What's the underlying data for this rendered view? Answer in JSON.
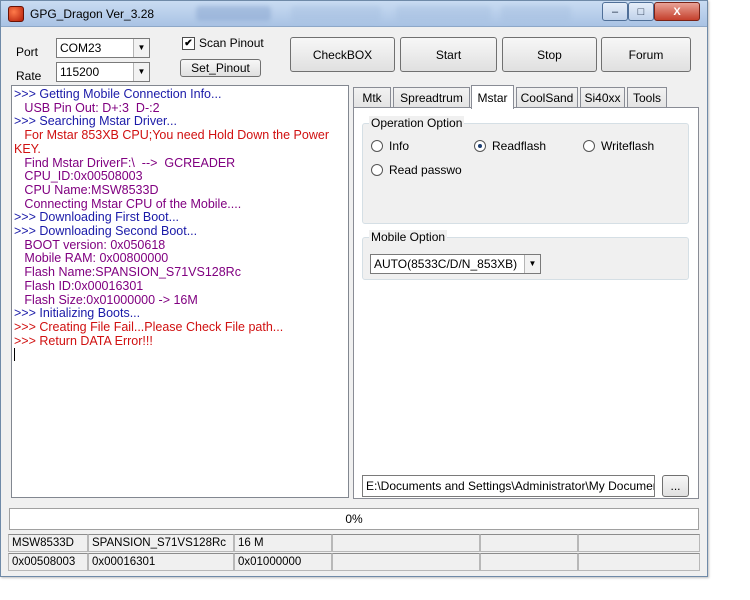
{
  "window": {
    "title": "GPG_Dragon  Ver_3.28",
    "controls": {
      "minimize": "–",
      "maximize": "□",
      "close": "X"
    }
  },
  "connection": {
    "port_label": "Port",
    "port_value": "COM23",
    "rate_label": "Rate",
    "rate_value": "115200",
    "scan_pinout_label": "Scan Pinout",
    "scan_pinout_checked": true,
    "set_pinout_label": "Set_Pinout"
  },
  "toolbar": {
    "checkbox_label": "CheckBOX",
    "start_label": "Start",
    "stop_label": "Stop",
    "forum_label": "Forum"
  },
  "log": [
    {
      "text": ">>> Getting Mobile Connection Info...",
      "color": "blue"
    },
    {
      "text": "   USB Pin Out: D+:3  D-:2",
      "color": "purple"
    },
    {
      "text": ">>> Searching Mstar Driver...",
      "color": "blue"
    },
    {
      "text": "   For Mstar 853XB CPU;You need Hold Down the Power KEY.",
      "color": "red"
    },
    {
      "text": "   Find Mstar DriverF:\\  -->  GCREADER",
      "color": "purple"
    },
    {
      "text": "   CPU_ID:0x00508003",
      "color": "purple"
    },
    {
      "text": "   CPU Name:MSW8533D",
      "color": "purple"
    },
    {
      "text": "   Connecting Mstar CPU of the Mobile....",
      "color": "purple"
    },
    {
      "text": ">>> Downloading First Boot...",
      "color": "blue"
    },
    {
      "text": ">>> Downloading Second Boot...",
      "color": "blue"
    },
    {
      "text": "   BOOT version: 0x050618",
      "color": "purple"
    },
    {
      "text": "   Mobile RAM: 0x00800000",
      "color": "purple"
    },
    {
      "text": "   Flash Name:SPANSION_S71VS128Rc",
      "color": "purple"
    },
    {
      "text": "   Flash ID:0x00016301",
      "color": "purple"
    },
    {
      "text": "   Flash Size:0x01000000 -> 16M",
      "color": "purple"
    },
    {
      "text": ">>> Initializing Boots...",
      "color": "blue"
    },
    {
      "text": ">>> Creating File Fail...Please Check File path...",
      "color": "red"
    },
    {
      "text": ">>> Return DATA Error!!!",
      "color": "red"
    }
  ],
  "tabs": [
    {
      "label": "Mtk",
      "active": false
    },
    {
      "label": "Spreadtrum",
      "active": false
    },
    {
      "label": "Mstar",
      "active": true
    },
    {
      "label": "CoolSand",
      "active": false
    },
    {
      "label": "Si40xx",
      "active": false
    },
    {
      "label": "Tools",
      "active": false
    }
  ],
  "mstar": {
    "operation_title": "Operation Option",
    "options": [
      {
        "label": "Info",
        "selected": false
      },
      {
        "label": "Readflash",
        "selected": true
      },
      {
        "label": "Writeflash",
        "selected": false
      },
      {
        "label": "Read passwo",
        "selected": false
      }
    ],
    "mobile_title": "Mobile Option",
    "mobile_value": "AUTO(8533C/D/N_853XB)",
    "path_value": "E:\\Documents and Settings\\Administrator\\My Documen",
    "browse_label": "..."
  },
  "progress": {
    "text": "0%",
    "fraction": 0
  },
  "status": {
    "row1": [
      "MSW8533D",
      "SPANSION_S71VS128Rc",
      "16 M",
      "",
      "",
      ""
    ],
    "row2": [
      "0x00508003",
      "0x00016301",
      "0x01000000",
      "",
      "",
      ""
    ]
  },
  "colors": {
    "log_blue": "#1a1aa8",
    "log_purple": "#800080",
    "log_red": "#d01010"
  }
}
